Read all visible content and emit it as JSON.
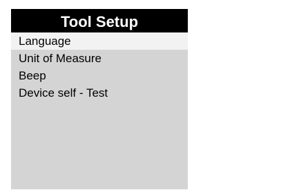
{
  "header": {
    "title": "Tool Setup"
  },
  "menu": {
    "selected_index": 0,
    "items": [
      {
        "label": "Language"
      },
      {
        "label": "Unit of Measure"
      },
      {
        "label": "Beep"
      },
      {
        "label": "Device self - Test"
      }
    ]
  },
  "colors": {
    "title_bg": "#000000",
    "title_text": "#ffffff",
    "screen_bg": "#d4d4d4",
    "selected_bg": "#f2f2f2"
  }
}
